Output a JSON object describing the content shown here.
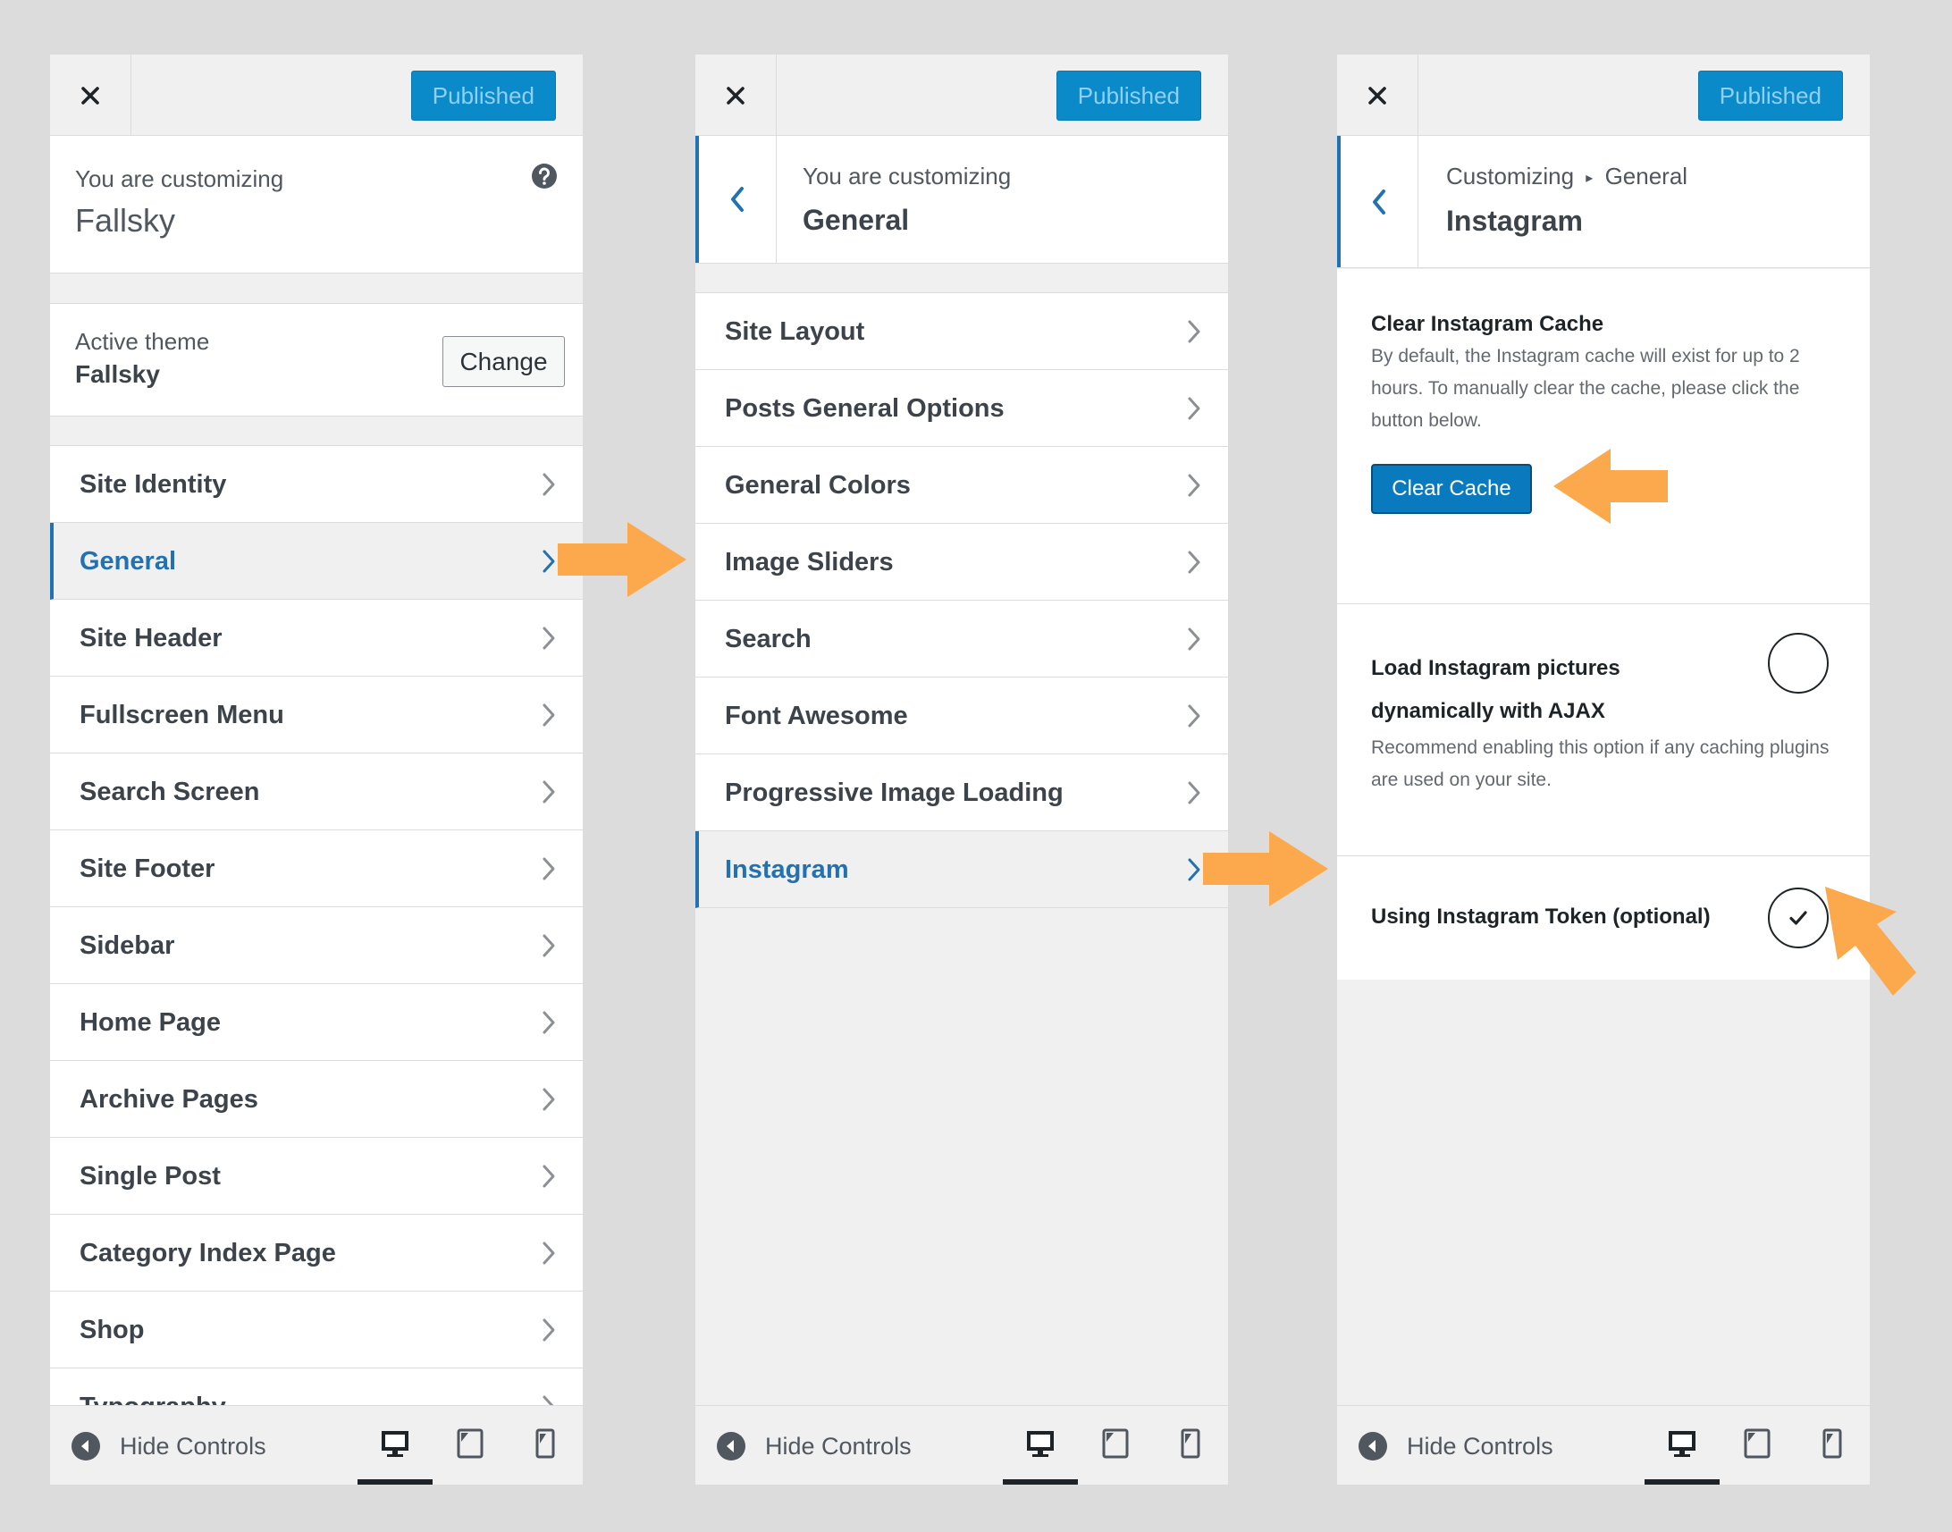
{
  "common": {
    "publish_label": "Published",
    "hide_controls_label": "Hide Controls"
  },
  "panel1": {
    "customizing_label": "You are customizing",
    "site_name": "Fallsky",
    "active_theme_label": "Active theme",
    "theme_name": "Fallsky",
    "change_label": "Change",
    "menu": [
      "Site Identity",
      "General",
      "Site Header",
      "Fullscreen Menu",
      "Search Screen",
      "Site Footer",
      "Sidebar",
      "Home Page",
      "Archive Pages",
      "Single Post",
      "Category Index Page",
      "Shop",
      "Typography"
    ],
    "active_item": "General"
  },
  "panel2": {
    "customizing_label": "You are customizing",
    "section_title": "General",
    "menu": [
      "Site Layout",
      "Posts General Options",
      "General Colors",
      "Image Sliders",
      "Search",
      "Font Awesome",
      "Progressive Image Loading",
      "Instagram"
    ],
    "active_item": "Instagram"
  },
  "panel3": {
    "breadcrumb_customizing": "Customizing",
    "breadcrumb_sep": "▸",
    "breadcrumb_section": "General",
    "section_title": "Instagram",
    "clear_cache_title": "Clear Instagram Cache",
    "clear_cache_desc": "By default, the Instagram cache will exist for up to 2 hours. To manually clear the cache, please click the button below.",
    "clear_cache_button": "Clear Cache",
    "ajax_title": "Load Instagram pictures dynamically with AJAX",
    "ajax_desc": "Recommend enabling this option if any caching plugins are used on your site.",
    "ajax_enabled": false,
    "token_title": "Using Instagram Token (optional)",
    "token_enabled": true
  },
  "colors": {
    "accent": "#2271b1",
    "publish_button": "#0a8ac9",
    "annotation_arrow": "#fba94c"
  }
}
